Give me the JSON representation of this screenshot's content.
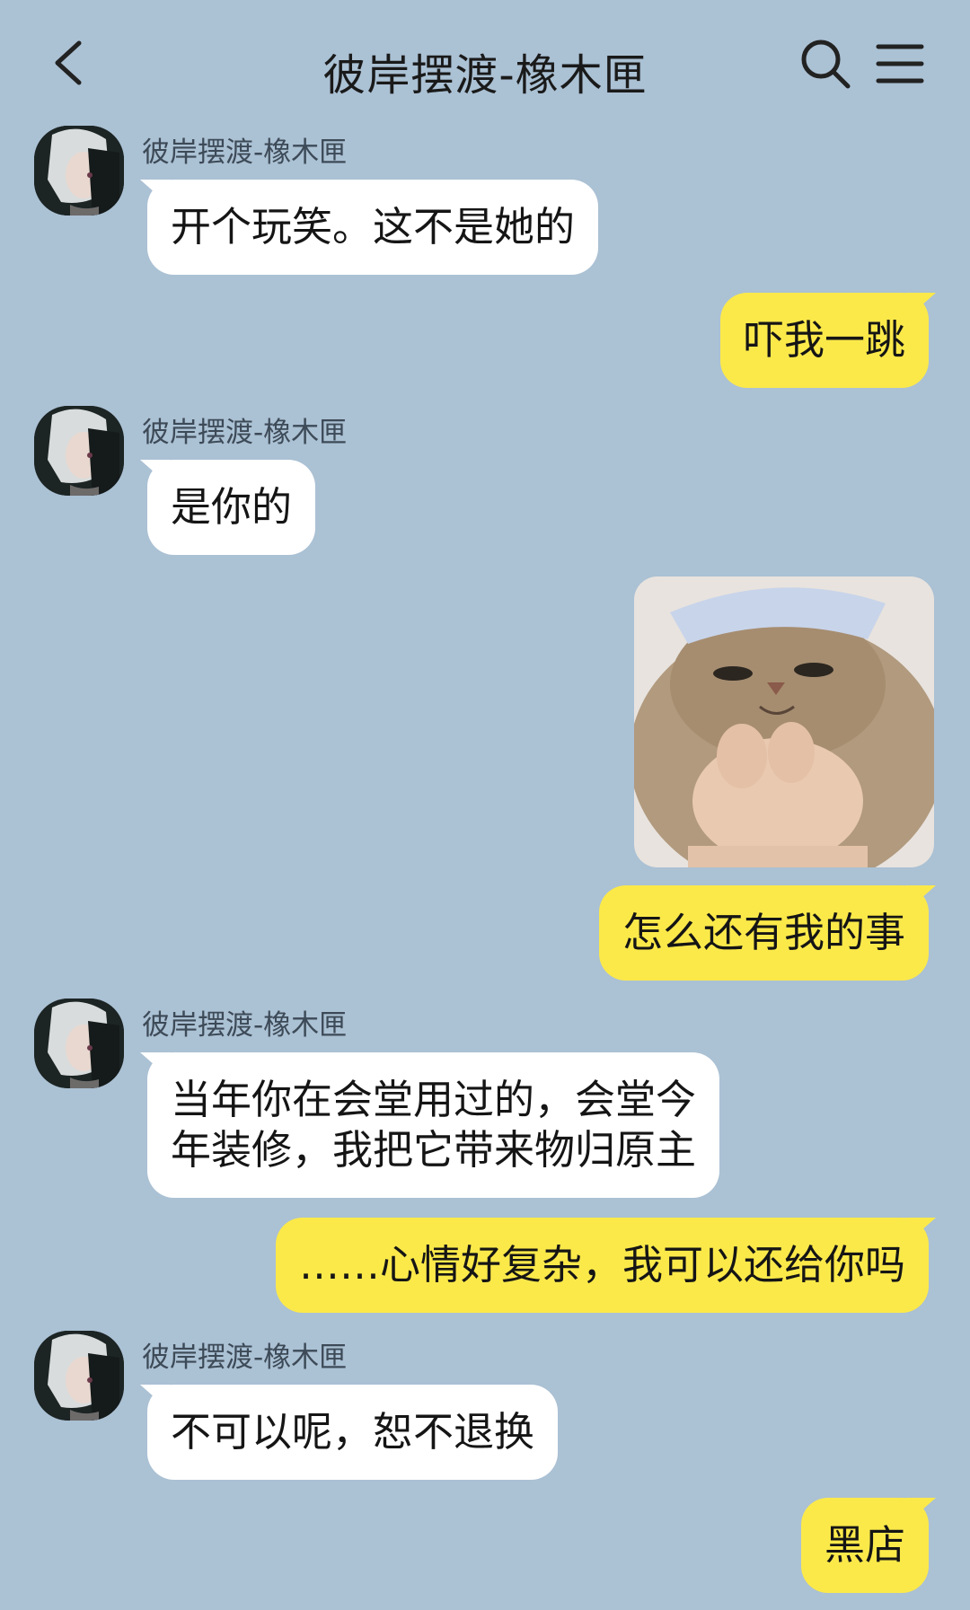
{
  "header": {
    "title": "彼岸摆渡-橡木匣"
  },
  "messages": [
    {
      "from": "contact",
      "sender": "彼岸摆渡-橡木匣",
      "text": "开个玩笑。这不是她的"
    },
    {
      "from": "me",
      "text": "吓我一跳"
    },
    {
      "from": "contact",
      "sender": "彼岸摆渡-橡木匣",
      "text": "是你的"
    },
    {
      "from": "me",
      "type": "sticker",
      "sticker": "cat-meme-sticker"
    },
    {
      "from": "me",
      "text": "怎么还有我的事"
    },
    {
      "from": "contact",
      "sender": "彼岸摆渡-橡木匣",
      "lines": [
        "当年你在会堂用过的，会堂今",
        "年装修，我把它带来物归原主"
      ]
    },
    {
      "from": "me",
      "text": "……心情好复杂，我可以还给你吗"
    },
    {
      "from": "contact",
      "sender": "彼岸摆渡-橡木匣",
      "text": "不可以呢，恕不退换"
    },
    {
      "from": "me",
      "text": "黑店"
    }
  ],
  "colors": {
    "background": "#abc1d4",
    "incoming_bubble": "#ffffff",
    "outgoing_bubble": "#fbe94a"
  },
  "icons": [
    "back-arrow-icon",
    "search-icon",
    "menu-icon"
  ]
}
